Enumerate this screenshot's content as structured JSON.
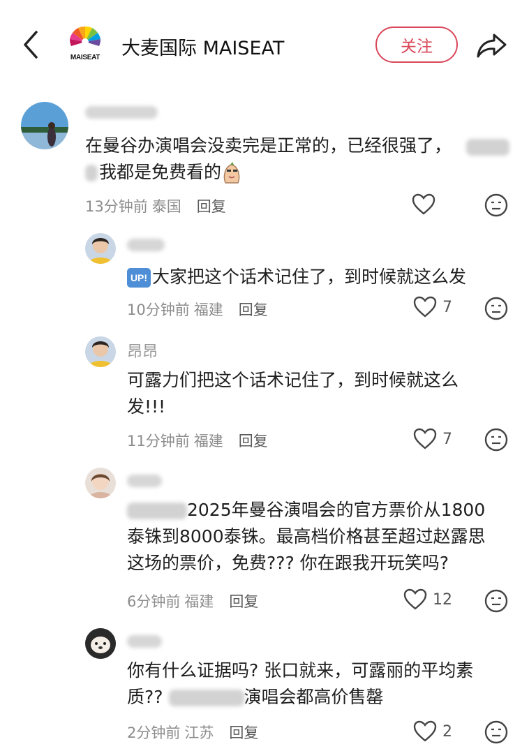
{
  "header": {
    "logo_text": "MAISEAT",
    "account_name": "大麦国际 MAISEAT",
    "follow_label": "关注"
  },
  "comments": [
    {
      "text_line1": "在曼谷办演唱会没卖完是正常的，已经很强了，",
      "text_line2": "我都是免费看的",
      "time": "13分钟前",
      "location": "泰国",
      "reply": "回复"
    },
    {
      "badge": "UP!",
      "text_line1": "大家把这个话术记住了，到时候就这么发",
      "time": "10分钟前",
      "location": "福建",
      "reply": "回复",
      "likes": "7"
    },
    {
      "user": "昂昂",
      "text_line1": "可露力们把这个话术记住了，到时候就这么",
      "text_line2": "发!!!",
      "time": "11分钟前",
      "location": "福建",
      "reply": "回复",
      "likes": "7"
    },
    {
      "text_line1": "2025年曼谷演唱会的官方票价从1800",
      "text_line2": "泰铢到8000泰铢。最高档价格甚至超过赵露思",
      "text_line3": "这场的票价，免费???  你在跟我开玩笑吗?",
      "time": "6分钟前",
      "location": "福建",
      "reply": "回复",
      "likes": "12"
    },
    {
      "text_line1": "你有什么证据吗? 张口就来，可露丽的平均素",
      "text_line2_a": "质??  ",
      "text_line2_b": "演唱会都高价售罄",
      "time": "2分钟前",
      "location": "江苏",
      "reply": "回复",
      "likes": "2"
    }
  ],
  "colors": {
    "accent": "#d9475a",
    "meta": "#8c8c8c",
    "up_badge": "#4d8ed6"
  }
}
